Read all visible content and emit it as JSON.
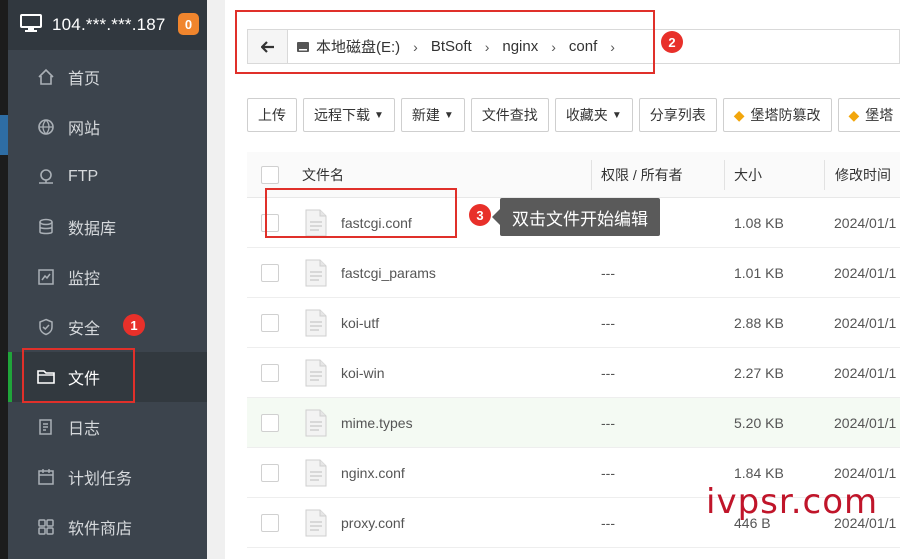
{
  "sidebar": {
    "server_ip": "104.***.***.187",
    "badge_count": "0",
    "items": [
      {
        "label": "首页",
        "icon": "home-icon"
      },
      {
        "label": "网站",
        "icon": "globe-icon"
      },
      {
        "label": "FTP",
        "icon": "ftp-icon"
      },
      {
        "label": "数据库",
        "icon": "database-icon"
      },
      {
        "label": "监控",
        "icon": "monitor-icon"
      },
      {
        "label": "安全",
        "icon": "shield-icon"
      },
      {
        "label": "文件",
        "icon": "folder-icon",
        "active": true
      },
      {
        "label": "日志",
        "icon": "log-icon"
      },
      {
        "label": "计划任务",
        "icon": "calendar-icon"
      },
      {
        "label": "软件商店",
        "icon": "apps-icon"
      }
    ]
  },
  "breadcrumb": {
    "segments": [
      "本地磁盘(E:)",
      "BtSoft",
      "nginx",
      "conf"
    ]
  },
  "toolbar": {
    "upload": "上传",
    "remote_download": "远程下载",
    "new": "新建",
    "find_file": "文件查找",
    "favorites": "收藏夹",
    "share_list": "分享列表",
    "tamper_protect": "堡塔防篡改",
    "tamper_protect_2": "堡塔"
  },
  "table": {
    "headers": {
      "name": "文件名",
      "permission": "权限 / 所有者",
      "size": "大小",
      "modified": "修改时间"
    },
    "rows": [
      {
        "name": "fastcgi.conf",
        "perm": "",
        "size": "1.08 KB",
        "modified": "2024/01/1"
      },
      {
        "name": "fastcgi_params",
        "perm": "---",
        "size": "1.01 KB",
        "modified": "2024/01/1"
      },
      {
        "name": "koi-utf",
        "perm": "---",
        "size": "2.88 KB",
        "modified": "2024/01/1"
      },
      {
        "name": "koi-win",
        "perm": "---",
        "size": "2.27 KB",
        "modified": "2024/01/1"
      },
      {
        "name": "mime.types",
        "perm": "---",
        "size": "5.20 KB",
        "modified": "2024/01/1"
      },
      {
        "name": "nginx.conf",
        "perm": "---",
        "size": "1.84 KB",
        "modified": "2024/01/1"
      },
      {
        "name": "proxy.conf",
        "perm": "---",
        "size": "446 B",
        "modified": "2024/01/1"
      }
    ]
  },
  "annotations": {
    "step1": "1",
    "step2": "2",
    "step3": "3",
    "tooltip": "双击文件开始编辑",
    "highlight_color": "#e0302a"
  },
  "watermark": "ivpsr.com",
  "colors": {
    "sidebar_bg": "#3c444d",
    "active_accent": "#20a53a",
    "badge": "#f0852d"
  }
}
